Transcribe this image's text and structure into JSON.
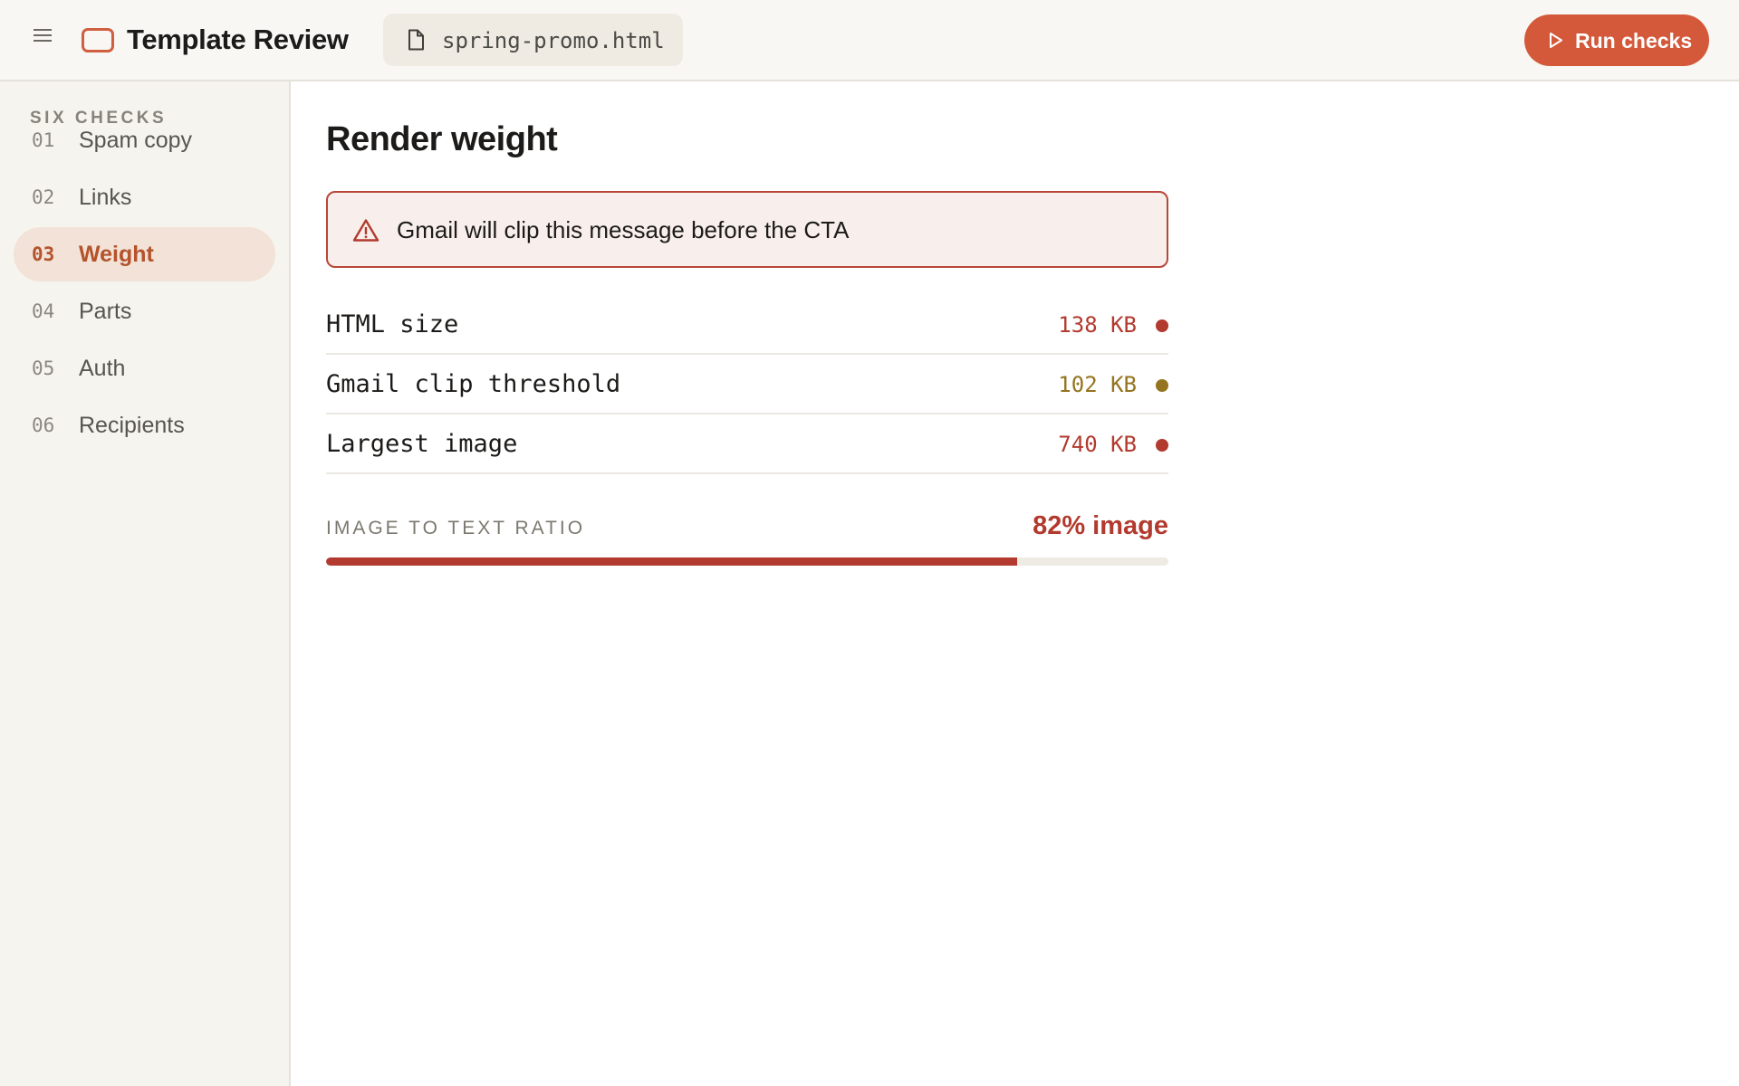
{
  "app": {
    "title": "Template Review",
    "brand_color": "#d4593a"
  },
  "file": {
    "name": "spring-promo.html"
  },
  "toolbar": {
    "run_label": "Run checks"
  },
  "sidebar": {
    "heading": "SIX CHECKS",
    "items": [
      {
        "num": "01",
        "label": "Spam copy",
        "active": false
      },
      {
        "num": "02",
        "label": "Links",
        "active": false
      },
      {
        "num": "03",
        "label": "Weight",
        "active": true
      },
      {
        "num": "04",
        "label": "Parts",
        "active": false
      },
      {
        "num": "05",
        "label": "Auth",
        "active": false
      },
      {
        "num": "06",
        "label": "Recipients",
        "active": false
      }
    ]
  },
  "main": {
    "title": "Render weight",
    "alert": {
      "icon": "warning-triangle-icon",
      "text": "Gmail will clip this message before the CTA",
      "color": "#b9463a"
    },
    "metrics": [
      {
        "label": "HTML size",
        "value": "138 KB",
        "status": "error",
        "color": "#b23a2e"
      },
      {
        "label": "Gmail clip threshold",
        "value": "102 KB",
        "status": "warning",
        "color": "#94741e"
      },
      {
        "label": "Largest image",
        "value": "740 KB",
        "status": "error",
        "color": "#b23a2e"
      }
    ],
    "ratio": {
      "label": "IMAGE TO TEXT RATIO",
      "value_text": "82% image",
      "percent": 82,
      "color": "#b23a2e"
    }
  }
}
